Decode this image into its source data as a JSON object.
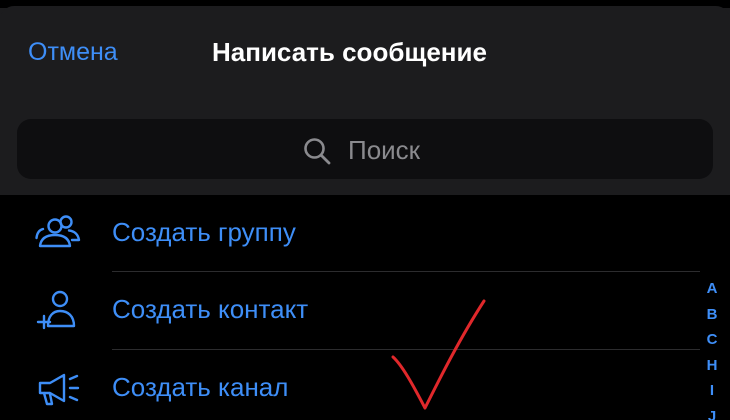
{
  "header": {
    "cancel_label": "Отмена",
    "title": "Написать сообщение"
  },
  "search": {
    "placeholder": "Поиск",
    "icon": "search-icon"
  },
  "actions": [
    {
      "label": "Создать группу",
      "icon": "group-icon"
    },
    {
      "label": "Создать контакт",
      "icon": "add-contact-icon"
    },
    {
      "label": "Создать канал",
      "icon": "megaphone-icon"
    }
  ],
  "alphabet_index": [
    "A",
    "B",
    "C",
    "H",
    "I",
    "J"
  ],
  "colors": {
    "accent": "#3e8ef7",
    "background": "#000000",
    "sheet": "#1c1c1e",
    "search_field": "#0e0e10",
    "checkmark": "#e0282b"
  }
}
